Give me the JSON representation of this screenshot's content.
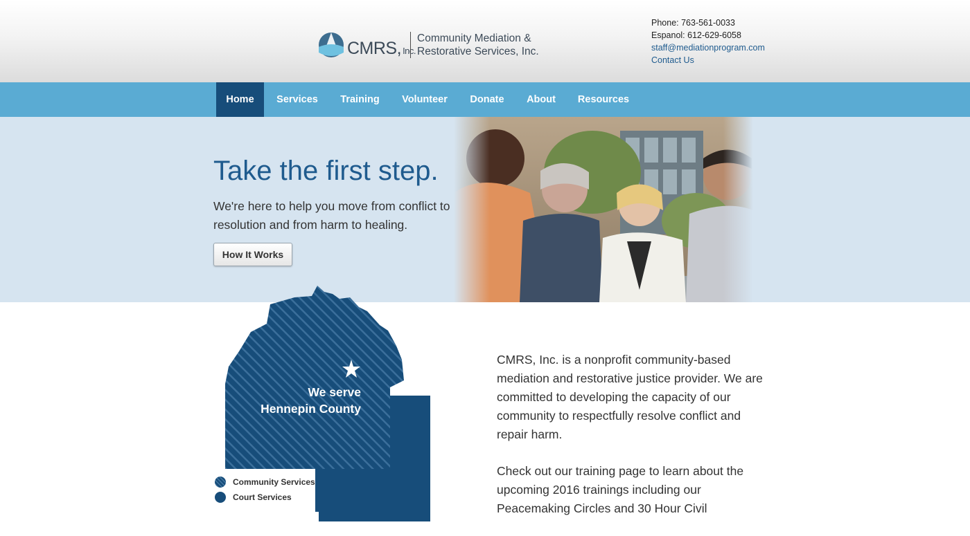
{
  "header": {
    "logo_cmrs": "CMRS,",
    "logo_inc": "Inc.",
    "logo_full_line1": "Community Mediation &",
    "logo_full_line2": "Restorative Services, Inc.",
    "phone": "Phone: 763-561-0033",
    "espanol": "Espanol: 612-629-6058",
    "email": "staff@mediationprogram.com",
    "contact": "Contact Us"
  },
  "nav": {
    "items": [
      {
        "label": "Home",
        "active": true
      },
      {
        "label": "Services"
      },
      {
        "label": "Training"
      },
      {
        "label": "Volunteer"
      },
      {
        "label": "Donate"
      },
      {
        "label": "About"
      },
      {
        "label": "Resources"
      }
    ]
  },
  "hero": {
    "title": "Take the first step.",
    "subtitle": "We're here to help you move from conflict to resolution and from harm to healing.",
    "button": "How It Works"
  },
  "map": {
    "line1": "We serve",
    "line2": "Hennepin County",
    "legend": [
      {
        "label": "Community Services"
      },
      {
        "label": "Court Services"
      }
    ]
  },
  "about": {
    "p1": "CMRS, Inc. is a nonprofit community-based mediation and restorative justice provider. We are committed to developing the capacity of our community to respectfully resolve conflict and repair harm.",
    "p2": "Check out our training page to learn about the upcoming 2016 trainings including our Peacemaking Circles and 30 Hour Civil"
  },
  "colors": {
    "brand_dark": "#174d7a",
    "nav_bg": "#5aabd3",
    "hero_bg": "#d6e4f0",
    "link": "#1f5b8e"
  }
}
